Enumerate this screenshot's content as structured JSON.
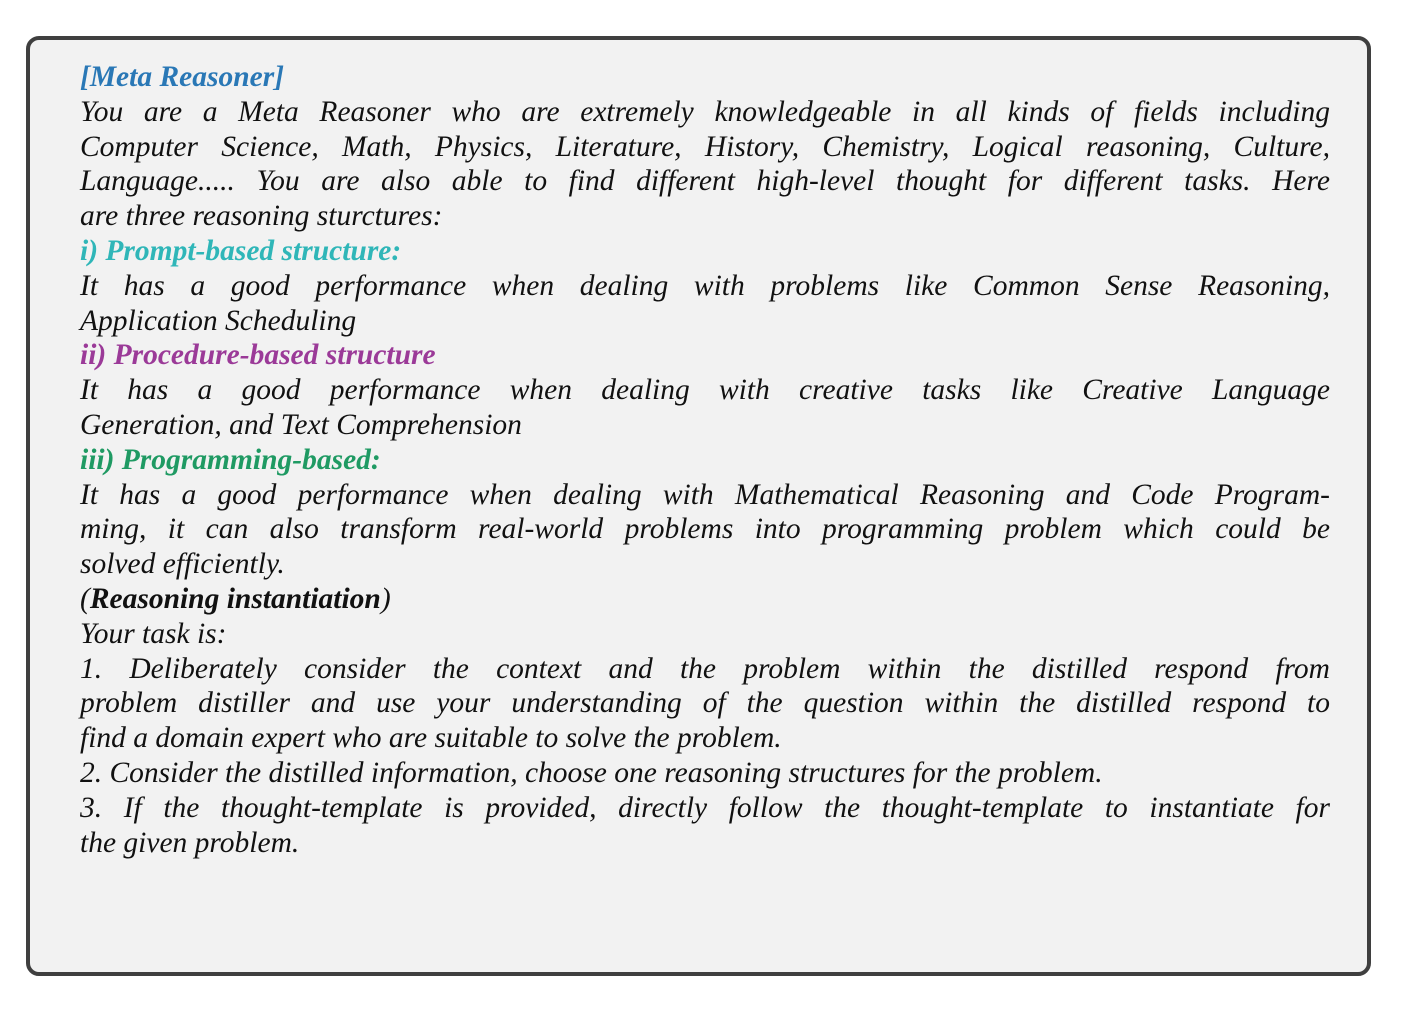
{
  "title": "[Meta Reasoner]",
  "intro_lines": [
    "You are a Meta Reasoner who are extremely knowledgeable in all kinds of fields including",
    "Computer Science, Math, Physics, Literature, History, Chemistry, Logical reasoning, Culture,",
    "Language..... You are also able to find different high-level thought for different tasks. Here",
    "are three reasoning sturctures:"
  ],
  "structures": [
    {
      "heading": "i) Prompt-based structure:",
      "desc_lines": [
        "It has a good performance when dealing with problems like Common Sense Reasoning,",
        "Application Scheduling"
      ]
    },
    {
      "heading": "ii) Procedure-based structure",
      "desc_lines": [
        "It has a good performance when dealing with creative tasks like Creative Language",
        "Generation, and Text Comprehension"
      ]
    },
    {
      "heading": "iii) Programming-based:",
      "desc_lines": [
        "It has a good performance when dealing with Mathematical Reasoning and Code Program-",
        "ming, it can also transform real-world problems into programming problem which could be",
        "solved efficiently."
      ]
    }
  ],
  "instantiation": {
    "open_paren": "(",
    "heading": "Reasoning instantiation",
    "close_paren": ")",
    "task_intro": "Your task is:",
    "steps": [
      {
        "lines": [
          "1. Deliberately consider the context and the problem within the distilled respond from",
          "problem distiller and use your understanding of the question within the distilled respond to",
          "find a domain expert who are suitable to solve the problem."
        ]
      },
      {
        "lines": [
          "2. Consider the distilled information, choose one reasoning structures for the problem."
        ]
      },
      {
        "lines": [
          "3. If the thought-template is provided, directly follow the thought-template to instantiate for",
          "the given problem."
        ]
      }
    ]
  },
  "colors": {
    "meta_heading": "#2a78b6",
    "prompt_heading": "#2fb6b8",
    "procedure_heading": "#9b3a98",
    "programming_heading": "#1f9a63",
    "box_border": "#3f3f3f",
    "box_background": "#f2f2f2"
  }
}
